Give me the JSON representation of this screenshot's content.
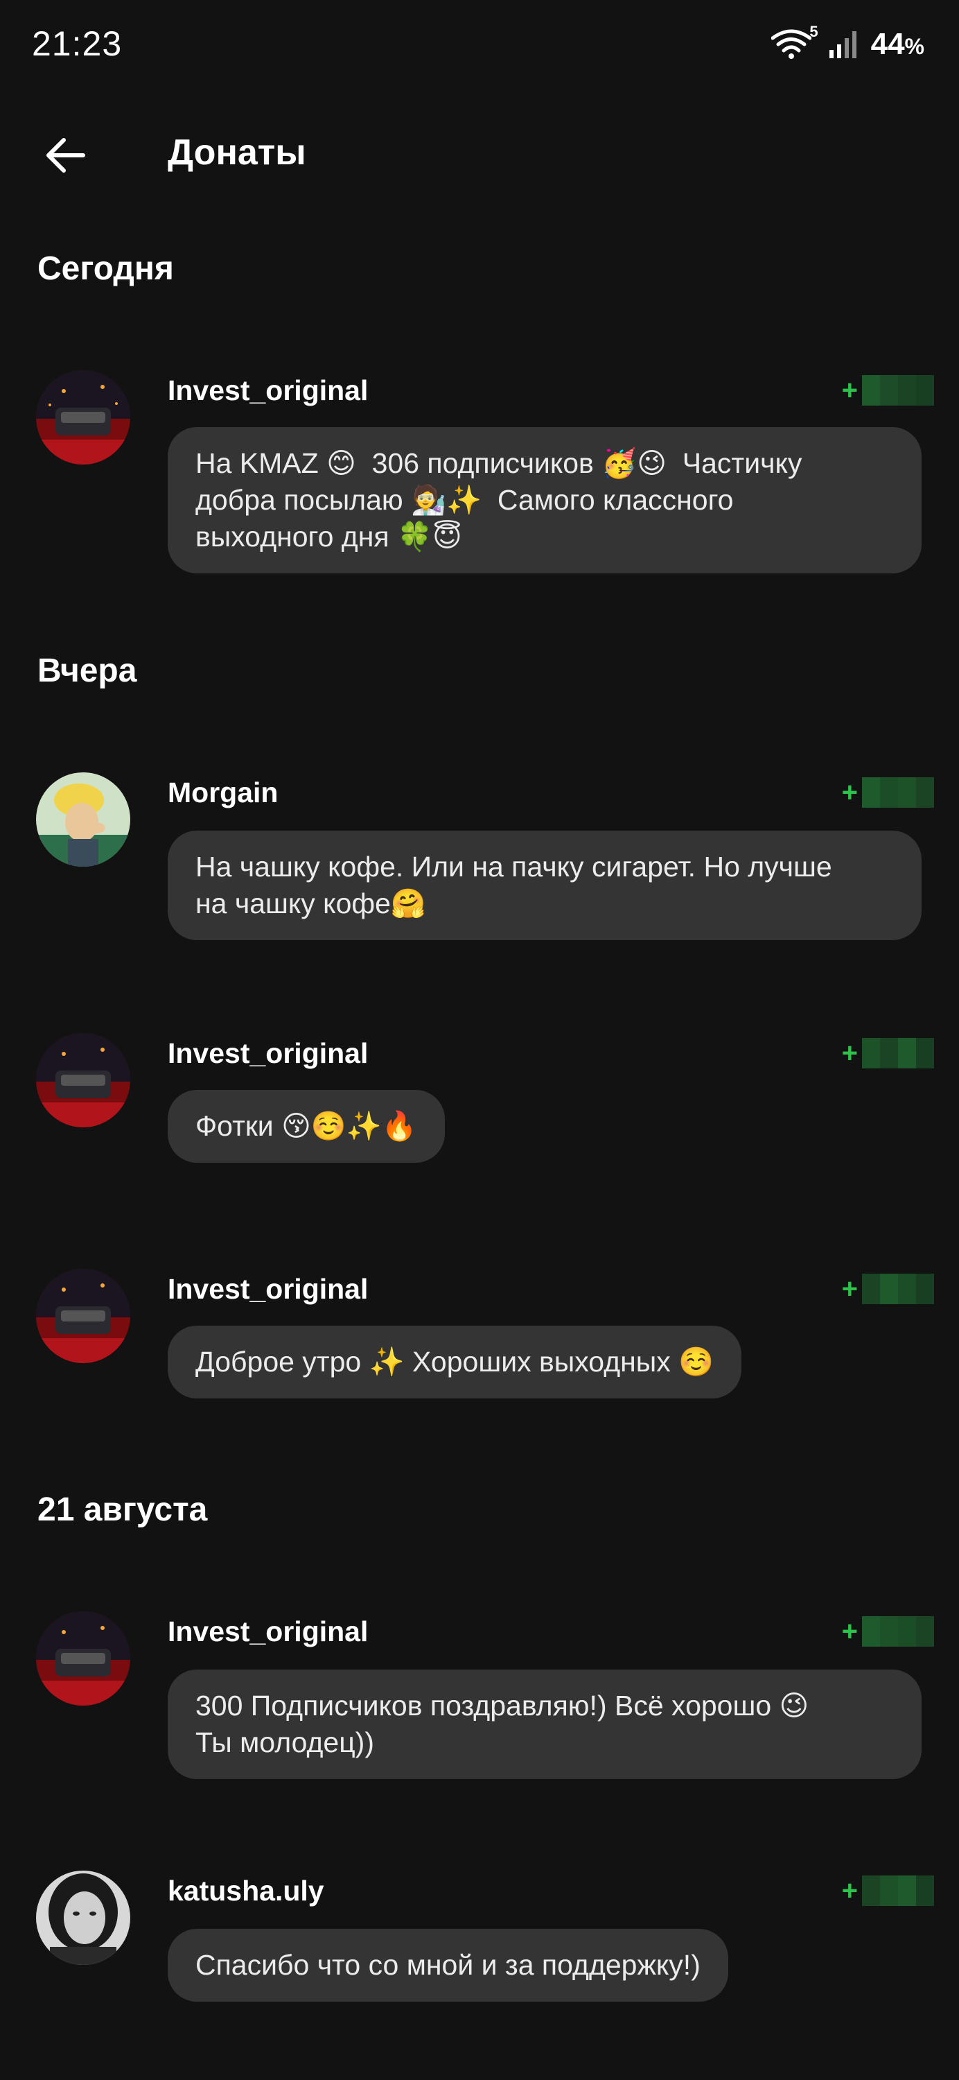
{
  "status_bar": {
    "time": "21:23",
    "wifi_badge": "5",
    "battery": "44",
    "battery_unit": "%"
  },
  "header": {
    "title": "Донаты",
    "back_icon": "arrow-left-icon"
  },
  "colors": {
    "background": "#121212",
    "bubble": "#343434",
    "amount_green": "#2ec24a"
  },
  "sections": [
    {
      "title": "Сегодня",
      "items": [
        {
          "name": "Invest_original",
          "amount_sign": "+",
          "message": "На KMAZ 😊  306 подписчиков 🥳😉  Частичку\nдобра посылаю 🧑‍🔬✨  Самого классного\nвыходного дня 🍀😇"
        }
      ]
    },
    {
      "title": "Вчера",
      "items": [
        {
          "name": "Morgain",
          "amount_sign": "+",
          "message": "На чашку кофе. Или на пачку сигарет. Но лучше\nна чашку кофе🤗"
        },
        {
          "name": "Invest_original",
          "amount_sign": "+",
          "message": "Фотки 😚☺️✨🔥"
        },
        {
          "name": "Invest_original",
          "amount_sign": "+",
          "message": "Доброе утро ✨ Хороших выходных ☺️"
        }
      ]
    },
    {
      "title": "21 августа",
      "items": [
        {
          "name": "Invest_original",
          "amount_sign": "+",
          "message": "300 Подписчиков поздравляю!) Всё хорошо 😉\nТы молодец))"
        },
        {
          "name": "katusha.uly",
          "amount_sign": "+",
          "message": "Спасибо что со мной и за поддержку!)"
        }
      ]
    }
  ]
}
